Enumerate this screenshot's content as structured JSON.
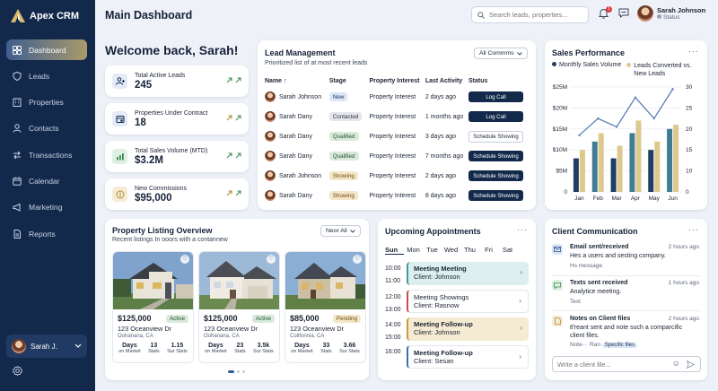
{
  "app": {
    "name": "Apex CRM"
  },
  "sidebar": {
    "items": [
      {
        "label": "Dashboard",
        "icon": "dashboard-icon"
      },
      {
        "label": "Leads",
        "icon": "shield-icon"
      },
      {
        "label": "Properties",
        "icon": "building-icon"
      },
      {
        "label": "Contacts",
        "icon": "person-icon"
      },
      {
        "label": "Transactions",
        "icon": "transactions-icon"
      },
      {
        "label": "Calendar",
        "icon": "calendar-icon"
      },
      {
        "label": "Marketing",
        "icon": "megaphone-icon"
      },
      {
        "label": "Reports",
        "icon": "document-icon"
      }
    ],
    "user": "Sarah J."
  },
  "header": {
    "title": "Main Dashboard",
    "search_placeholder": "Search leads, properties...",
    "notification_count": "1",
    "user_name": "Sarah Johnson",
    "user_status": "Status"
  },
  "welcome": "Welcome back, Sarah!",
  "stats": [
    {
      "label": "Total Active Leads",
      "value": "245"
    },
    {
      "label": "Properties Under Contract",
      "value": "18"
    },
    {
      "label": "Total Sales Volume (MTD)",
      "value": "$3.2M"
    },
    {
      "label": "New Commissions",
      "value": "$95,000"
    }
  ],
  "lead_management": {
    "title": "Lead Management",
    "subtitle": "Prioritized list of at most recent leads",
    "filter": "All Commms",
    "columns": [
      "Name",
      "Stage",
      "Property Interest",
      "Last Activity",
      "Status"
    ],
    "rows": [
      {
        "name": "Sarah Johnson",
        "stage": "New",
        "interest": "Property Interest",
        "activity": "2 days ago",
        "action": "Log Call"
      },
      {
        "name": "Sarah Dany",
        "stage": "Contacted",
        "interest": "Property Interest",
        "activity": "1 months ago",
        "action": "Log Call"
      },
      {
        "name": "Sarah Dany",
        "stage": "Qualified",
        "interest": "Property Interest",
        "activity": "3 days ago",
        "action": "Schedule Showing"
      },
      {
        "name": "Sarah Dany",
        "stage": "Qualified",
        "interest": "Property Interest",
        "activity": "7 months ago",
        "action": "Schedule Showing"
      },
      {
        "name": "Sarah Johnson",
        "stage": "Showing",
        "interest": "Property Interest",
        "activity": "2 days ago",
        "action": "Schedule Showing"
      },
      {
        "name": "Sarah Dany",
        "stage": "Showing",
        "interest": "Property Interest",
        "activity": "8 days ago",
        "action": "Schedule Showing"
      }
    ]
  },
  "sales_performance": {
    "title": "Sales Performance",
    "legend": [
      "Monthly Sales Volume",
      "Leads Converted vs. New Leads"
    ]
  },
  "chart_data": {
    "type": "bar",
    "title": "Sales Performance",
    "categories": [
      "Jan",
      "Feb",
      "Mar",
      "Apr",
      "May",
      "Jun"
    ],
    "left_ticks": [
      "$25M",
      "$20M",
      "$15M",
      "$10M",
      "$5M",
      "0"
    ],
    "right_ticks": [
      "30",
      "25",
      "20",
      "15",
      "10",
      "0"
    ],
    "ylim": [
      0,
      25
    ],
    "ylim_right": [
      0,
      30
    ],
    "series": [
      {
        "name": "Monthly Sales Volume",
        "type": "bar",
        "values": [
          8,
          12,
          8,
          14,
          10,
          15
        ]
      },
      {
        "name": "Leads Converted vs. New Leads",
        "type": "bar",
        "values": [
          10,
          14,
          11,
          17,
          12,
          16
        ]
      },
      {
        "name": "Trend",
        "type": "line",
        "values": [
          13.5,
          17.5,
          15.5,
          22.5,
          17.5,
          24.5
        ]
      }
    ],
    "colors": {
      "bar_dark": "#1f3e63",
      "bar_teal": "#3f7d92",
      "bar_gold": "#ddc88e",
      "line": "#5a7fb5"
    }
  },
  "listings": {
    "title": "Property Listing Overview",
    "subtitle": "Recent listings In ooors with a contannew",
    "filter": "Neor All",
    "items": [
      {
        "price": "$125,000",
        "status": "Active",
        "address": "123 Oceanview Dr",
        "city": "Oohanana, CA",
        "metrics": [
          {
            "v": "Days",
            "l": "on Market"
          },
          {
            "v": "13",
            "l": "Stats"
          },
          {
            "v": "1.15",
            "l": "Sur Stats"
          }
        ]
      },
      {
        "price": "$125,000",
        "status": "Active",
        "address": "123 Oceanview Dr",
        "city": "Oohanana, CA",
        "metrics": [
          {
            "v": "Days",
            "l": "on Market"
          },
          {
            "v": "23",
            "l": "Stats"
          },
          {
            "v": "3.5k",
            "l": "Sur Stats"
          }
        ]
      },
      {
        "price": "$85,000",
        "status": "Pending",
        "address": "123 Oceanview Dr",
        "city": "Colifonnia, CA",
        "metrics": [
          {
            "v": "Days",
            "l": "on Market"
          },
          {
            "v": "33",
            "l": "Stats"
          },
          {
            "v": "3.66",
            "l": "Sur Stats"
          }
        ]
      }
    ]
  },
  "appointments": {
    "title": "Upcoming Appointments",
    "days": [
      "Sun",
      "Mon",
      "Tue",
      "Wed",
      "Thu",
      "Fri",
      "Sat"
    ],
    "times": [
      "10:00",
      "11:00",
      "12:00",
      "13:00",
      "14:00",
      "15:00",
      "16:00"
    ],
    "items": [
      {
        "title": "Meeting Meeting",
        "client": "Client: Johnson"
      },
      {
        "title": "Meeting Showings",
        "client": "Client: Rasnow"
      },
      {
        "title": "Meeting Follow-up",
        "client": "Client: Johnson"
      },
      {
        "title": "Meeting Follow-up",
        "client": "Client: Sesan"
      }
    ]
  },
  "communication": {
    "title": "Client Communication",
    "items": [
      {
        "title": "Email sent/received",
        "time": "2 hours ago",
        "body": "Hes a users and sesting company.",
        "sub": "Hs message"
      },
      {
        "title": "Texts sent received",
        "time": "1 hours ago",
        "body": "Analytice meeting.",
        "sub": "Text"
      },
      {
        "title": "Notes on Client files",
        "time": "2 hours ago",
        "body": "tl'reant sent and note such a comparcific client files.",
        "sub": "Note··· Ran",
        "chip": "Specific files"
      }
    ],
    "compose_placeholder": "Write a client file..."
  }
}
